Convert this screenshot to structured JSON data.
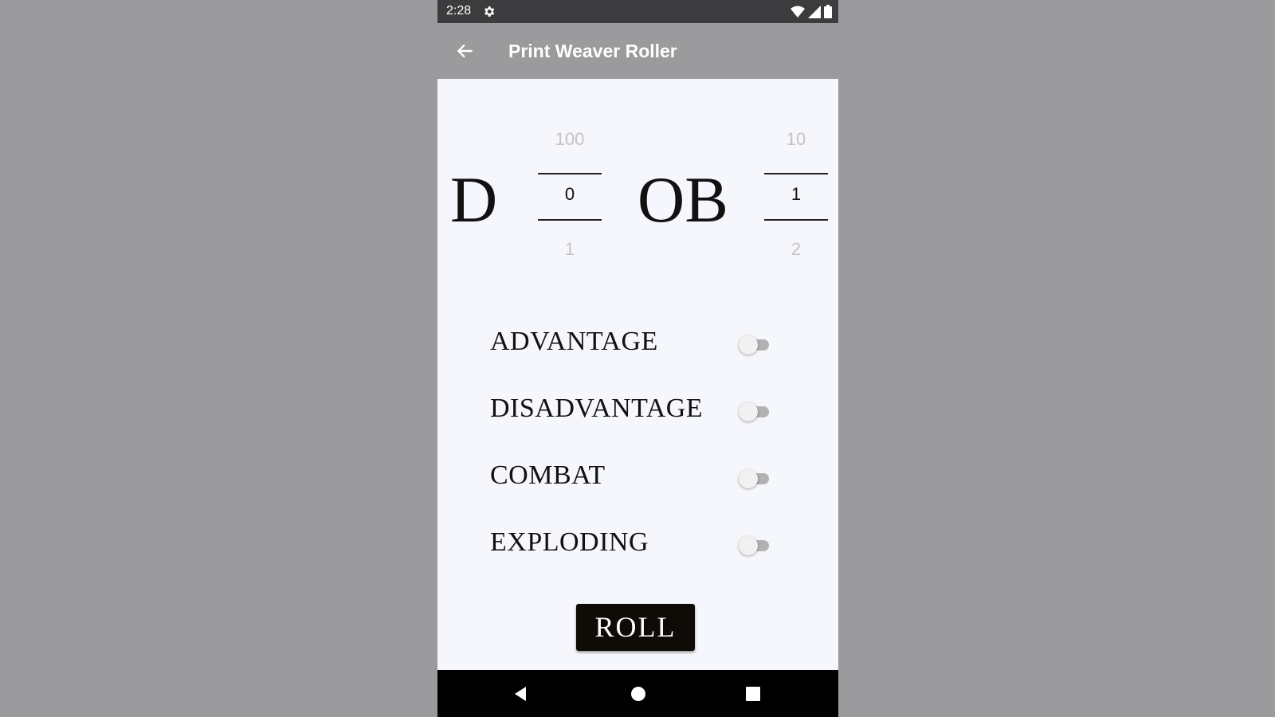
{
  "status_bar": {
    "time": "2:28",
    "icons": [
      "gear-icon",
      "wifi-icon",
      "signal-icon",
      "battery-icon"
    ]
  },
  "app_bar": {
    "title": "Print Weaver Roller",
    "back_icon": "arrow-left-icon",
    "background": "#9b9a9c"
  },
  "dice": {
    "d_label": "D",
    "ob_label": "OB",
    "d_picker": {
      "above": "100",
      "value": "0",
      "below": "1"
    },
    "ob_picker": {
      "above": "10",
      "value": "1",
      "below": "2"
    }
  },
  "options": [
    {
      "label": "ADVANTAGE",
      "on": false
    },
    {
      "label": "DISADVANTAGE",
      "on": false
    },
    {
      "label": "COMBAT",
      "on": false
    },
    {
      "label": "EXPLODING",
      "on": false
    }
  ],
  "roll_button": {
    "label": "ROLL",
    "background": "#0f0c08"
  },
  "nav_bar": {
    "icons": [
      "back-triangle-icon",
      "home-circle-icon",
      "recents-square-icon"
    ]
  }
}
